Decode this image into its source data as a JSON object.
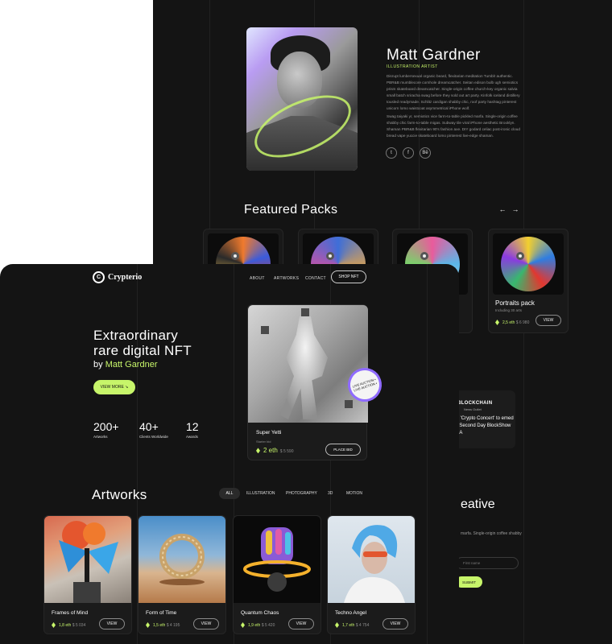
{
  "artist": {
    "name": "Matt Gardner",
    "role": "ILLUSTRATION ARTIST",
    "bio_p1": "Disrupt lumbersexual organic beard, flexitarian meditation Tumblr authentic. PBR&B mumblecore cornhole dreamcatcher. Seitan edison bulb ugh semiotics prism skateboard dreamcatcher. Single-origin coffee church-key organic salvia small batch sriracha swag before they sold out art party. Kinfolk iceland distillery tousled readymade. Schlitz cardigan shabby chic, roof party hashtag pinterest unicorn lomo waistcoat asymmetrical iPhone wolf.",
    "bio_p2": "Swag taiyaki yr, semiotics vice farm-to-table pickled marfa. Single-origin coffee shabby chic farm-to-table migas. Subway tile viral iPhone aesthetic Brooklyn. Shaman PBR&B flexitarian 90's fashion axe. DIY godard celiac post-ironic cloud bread vape yuccie skateboard lomo pinterest live-edge shaman.",
    "socials": [
      "twitter-icon",
      "facebook-icon",
      "behance-icon"
    ]
  },
  "featured": {
    "title": "Featured Packs",
    "prev": "←",
    "next": "→",
    "packs": [
      {
        "name": "",
        "colors": [
          "#f07a2d",
          "#3b5bdb",
          "#222"
        ]
      },
      {
        "name": "",
        "colors": [
          "#f2a93b",
          "#3e6ed8",
          "#d94e9e"
        ]
      },
      {
        "name": "",
        "colors": [
          "#e95b9c",
          "#5bb6e8",
          "#e9e9e9"
        ]
      },
      {
        "name": "Portraits pack",
        "sub": "Including 30 arts",
        "price": "2,5 eth",
        "usd": "$ 6 980",
        "button": "VIEW",
        "colors": [
          "#f2cf2f",
          "#2f7de1",
          "#e2372f"
        ]
      }
    ]
  },
  "news": {
    "brand": "BLOCKCHAIN",
    "outlet": "News Outlet",
    "headline": "rist 'Crypto Concert' to emed on Second Day BlockShow USA"
  },
  "newsletter": {
    "title": "eative",
    "text": "marfa. Single-origin coffee shabby",
    "placeholder": "First name",
    "button": "SUBMIT"
  },
  "nav": {
    "brand": "Crypterio",
    "logo_letter": "C",
    "links": [
      "ABOUT",
      "ARTWORKS",
      "CONTACT"
    ],
    "shop": "SHOP NFT"
  },
  "hero": {
    "line1": "Extraordinary",
    "line2": "rare digital NFT",
    "by": "by",
    "artist": "Matt Gardner",
    "button": "VIEW MORE ↘",
    "stats": [
      {
        "value": "200+",
        "label": "Artworks"
      },
      {
        "value": "40+",
        "label": "Clients Worldwide"
      },
      {
        "value": "12",
        "label": "Awards"
      }
    ],
    "card": {
      "name": "Super Yetti",
      "sub": "Starter bid",
      "price": "2 eth",
      "usd": "$ 5 590",
      "button": "PLACE BID",
      "badge": "LIVE AUCTION • LIVE AUCTION •"
    }
  },
  "artworks": {
    "title": "Artworks",
    "filters": [
      "ALL",
      "ILLUSTRATION",
      "PHOTOGRAPHY",
      "3D",
      "MOTION"
    ],
    "items": [
      {
        "name": "Frames of Mind",
        "price": "1,8 eth",
        "usd": "$ 5 034",
        "button": "VIEW"
      },
      {
        "name": "Form of Time",
        "price": "1,5 eth",
        "usd": "$ 4 195",
        "button": "VIEW"
      },
      {
        "name": "Quantum Chaos",
        "price": "1,9 eth",
        "usd": "$ 5 420",
        "button": "VIEW"
      },
      {
        "name": "Techno Angel",
        "price": "1,7 eth",
        "usd": "$ 4 754",
        "button": "VIEW"
      }
    ]
  },
  "colors": {
    "accent": "#c7f56a",
    "background": "#141414",
    "card": "#1b1b1b"
  }
}
